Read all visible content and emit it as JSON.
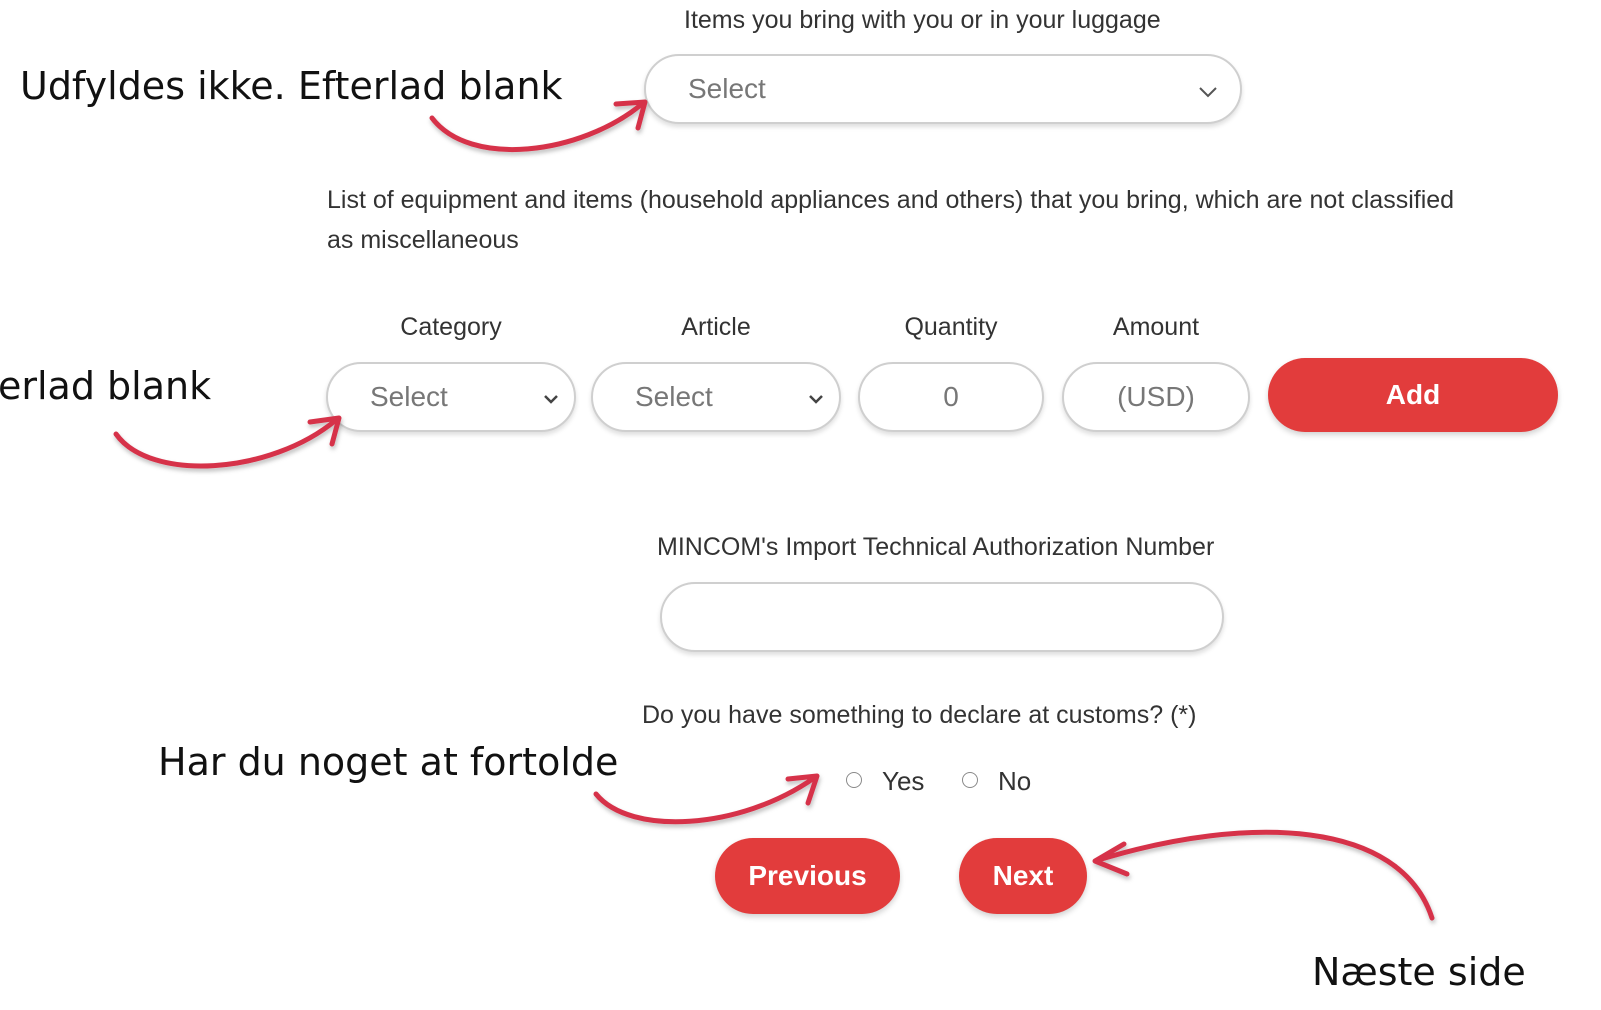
{
  "luggage": {
    "label": "Items you bring with you or in your luggage",
    "select_value": "Select"
  },
  "equipment": {
    "description_line1": "List of equipment and items (household appliances and others) that you bring, which are not classified",
    "description_line2": "as miscellaneous",
    "columns": {
      "category": "Category",
      "article": "Article",
      "quantity": "Quantity",
      "amount": "Amount"
    },
    "category_value": "Select",
    "article_value": "Select",
    "quantity_placeholder": "0",
    "amount_placeholder": "(USD)",
    "add_label": "Add"
  },
  "mincom": {
    "label": "MINCOM's Import Technical Authorization Number",
    "value": ""
  },
  "customs": {
    "question": "Do you have something to declare at customs? (*)",
    "options": [
      "Yes",
      "No"
    ]
  },
  "nav": {
    "previous_label": "Previous",
    "next_label": "Next"
  },
  "annotations": {
    "luggage_note": "Udfyldes ikke. Efterlad blank",
    "equipment_note": "erlad blank",
    "customs_note": "Har du noget at fortolde",
    "next_note": "Næste side"
  },
  "colors": {
    "accent": "#e23c3c",
    "arrow": "#d6324a"
  }
}
